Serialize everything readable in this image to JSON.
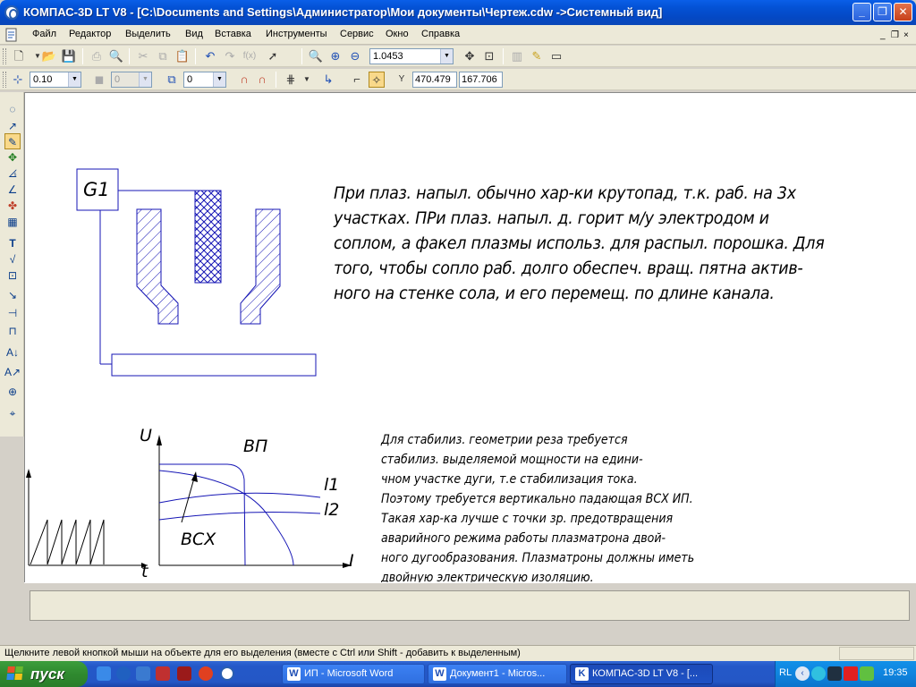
{
  "window": {
    "title": "КОМПАС-3D LT V8 - [C:\\Documents and Settings\\Администратор\\Мои документы\\Чертеж.cdw ->Системный вид]",
    "minimize": "_",
    "restore": "❐",
    "close": "✕"
  },
  "menu": {
    "items": [
      "Файл",
      "Редактор",
      "Выделить",
      "Вид",
      "Вставка",
      "Инструменты",
      "Сервис",
      "Окно",
      "Справка"
    ],
    "doc_controls": [
      "_",
      "❐",
      "×"
    ]
  },
  "toolbar1": {
    "zoom_value": "1.0453"
  },
  "toolbar2": {
    "line_scale": "0.10",
    "layer_value": "0",
    "layer_num": "0",
    "coord_x": "470.479",
    "coord_y": "167.706"
  },
  "drawing": {
    "g1_label": "G1",
    "big_text": [
      "При плаз. напыл. обычно хар-ки крутопад, т.к. раб. на 3х",
      "участках. ПРи плаз. напыл. д. горит м/у электродом и",
      "соплом, а факел плазмы использ. для распыл. порошка. Для",
      "того, чтобы сопло раб. долго обеспеч. вращ. пятна актив-",
      "ного на стенке сола, и его перемещ. по длине канала."
    ],
    "small_text": [
      "Для стабилиз. геометрии реза требуется",
      "стабилиз. выделяемой мощности на едини-",
      "чном участке дуги, т.е стабилизация тока.",
      "Поэтому требуется вертикально падающая ВСХ ИП.",
      "Такая хар-ка лучше с точки зр. предотвращения",
      "аварийного режима работы плазматрона двой-",
      "ного дугообразования. Плазматроны должны иметь",
      "двойную электрическую изоляцию."
    ],
    "graph_labels": {
      "u": "U",
      "vp": "ВП",
      "l1": "l1",
      "l2": "l2",
      "vsx": "ВСХ",
      "i": "I",
      "t": "t"
    }
  },
  "status": {
    "hint": "Щелкните левой кнопкой мыши на объекте для его выделения (вместе с Ctrl или Shift - добавить к выделенным)"
  },
  "taskbar": {
    "start": "пуск",
    "tasks": [
      {
        "label": "ИП - Microsoft Word",
        "icon": "W"
      },
      {
        "label": "Документ1 - Micros...",
        "icon": "W"
      },
      {
        "label": "КОМПАС-3D LT V8 - [...",
        "icon": "K"
      }
    ],
    "lang": "RL",
    "clock": "19:35"
  }
}
